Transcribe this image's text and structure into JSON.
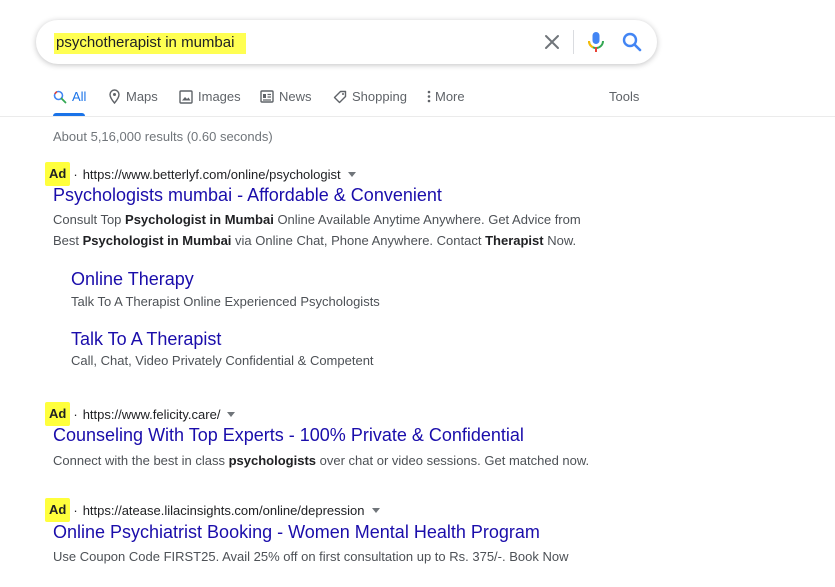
{
  "search": {
    "query": "psychotherapist in mumbai"
  },
  "tabs": [
    {
      "label": "All",
      "icon": "search-icon"
    },
    {
      "label": "Maps",
      "icon": "map-pin-icon"
    },
    {
      "label": "Images",
      "icon": "image-icon"
    },
    {
      "label": "News",
      "icon": "news-icon"
    },
    {
      "label": "Shopping",
      "icon": "tag-icon"
    },
    {
      "label": "More",
      "icon": "more-vert-icon"
    }
  ],
  "tools_label": "Tools",
  "stats": "About 5,16,000 results (0.60 seconds)",
  "ads": [
    {
      "ad_label": "Ad",
      "separator": "·",
      "url": "https://www.betterlyf.com/online/psychologist",
      "title": "Psychologists mumbai - Affordable & Convenient",
      "desc_line1": {
        "p1": "Consult Top ",
        "b1": "Psychologist in Mumbai",
        "p2": " Online Available Anytime Anywhere. Get Advice from"
      },
      "desc_line2": {
        "p1": "Best ",
        "b1": "Psychologist in Mumbai",
        "p2": " via Online Chat, Phone Anywhere. Contact ",
        "b2": "Therapist",
        "p3": " Now."
      },
      "sitelinks": [
        {
          "title": "Online Therapy",
          "desc": "Talk To A Therapist Online Experienced Psychologists"
        },
        {
          "title": "Talk To A Therapist",
          "desc": "Call, Chat, Video Privately Confidential & Competent"
        }
      ]
    },
    {
      "ad_label": "Ad",
      "separator": "·",
      "url": "https://www.felicity.care/",
      "title": "Counseling With Top Experts - 100% Private & Confidential",
      "desc": {
        "p1": "Connect with the best in class ",
        "b1": "psychologists",
        "p2": " over chat or video sessions. Get matched now."
      }
    },
    {
      "ad_label": "Ad",
      "separator": "·",
      "url": "https://atease.lilacinsights.com/online/depression",
      "title": "Online Psychiatrist Booking - Women Mental Health Program",
      "desc": "Use Coupon Code FIRST25. Avail 25% off on first consultation up to Rs. 375/-. Book Now"
    }
  ],
  "colors": {
    "link": "#1a0dab",
    "accent": "#1a73e8",
    "highlight": "#ffff3c"
  }
}
